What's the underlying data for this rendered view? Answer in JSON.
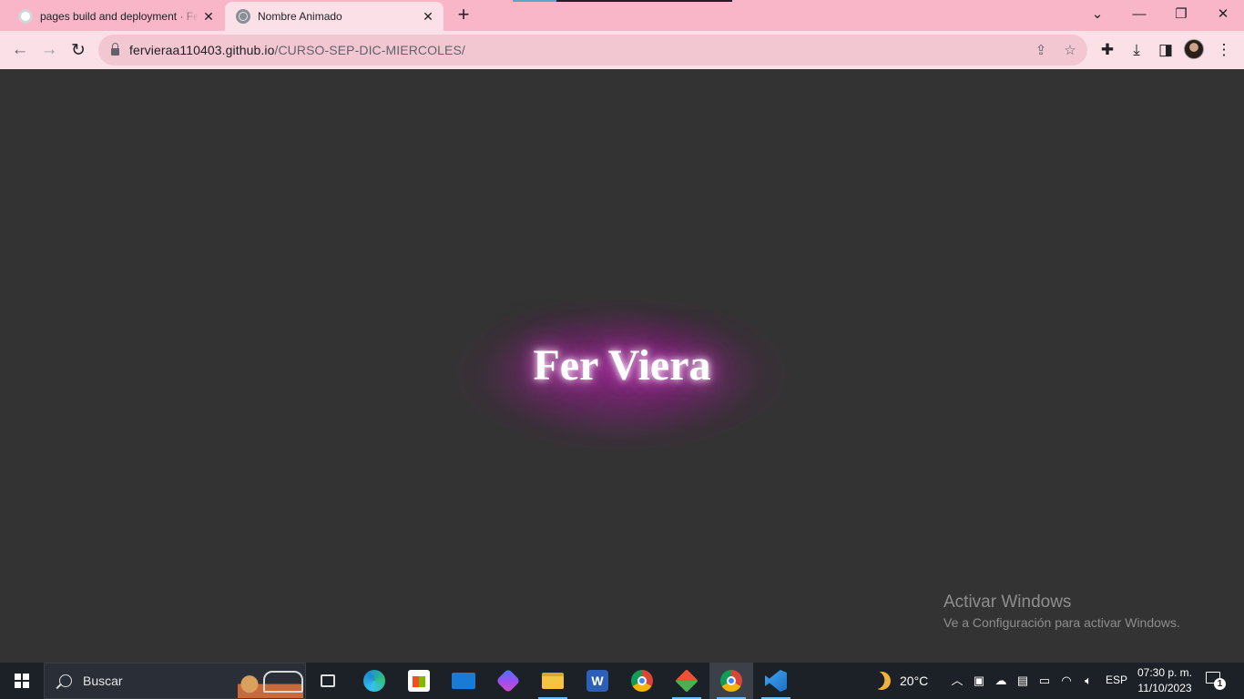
{
  "browser": {
    "tabs": [
      {
        "title": "pages build and deployment · Fe",
        "icon": "github-icon",
        "active": false
      },
      {
        "title": "Nombre Animado",
        "icon": "globe-icon",
        "active": true
      }
    ],
    "new_tab_label": "+",
    "close_label": "✕",
    "url_host": "fervieraa110403.github.io",
    "url_path": "/CURSO-SEP-DIC-MIERCOLES/",
    "window_controls": {
      "dropdown": "⌄",
      "minimize": "—",
      "restore": "❐",
      "close": "✕"
    }
  },
  "page": {
    "name": "Fer Viera",
    "glow_color": "#b02ba6",
    "background": "#333333"
  },
  "watermark": {
    "title": "Activar Windows",
    "subtitle": "Ve a Configuración para activar Windows."
  },
  "taskbar": {
    "search_placeholder": "Buscar",
    "apps": [
      "task-view",
      "edge",
      "microsoft-store",
      "mail",
      "copilot",
      "file-explorer",
      "word",
      "chrome",
      "git",
      "chrome-profile",
      "vscode"
    ],
    "weather_temp": "20°C",
    "language": "ESP",
    "time": "07:30 p. m.",
    "date": "11/10/2023",
    "notification_count": "1"
  }
}
